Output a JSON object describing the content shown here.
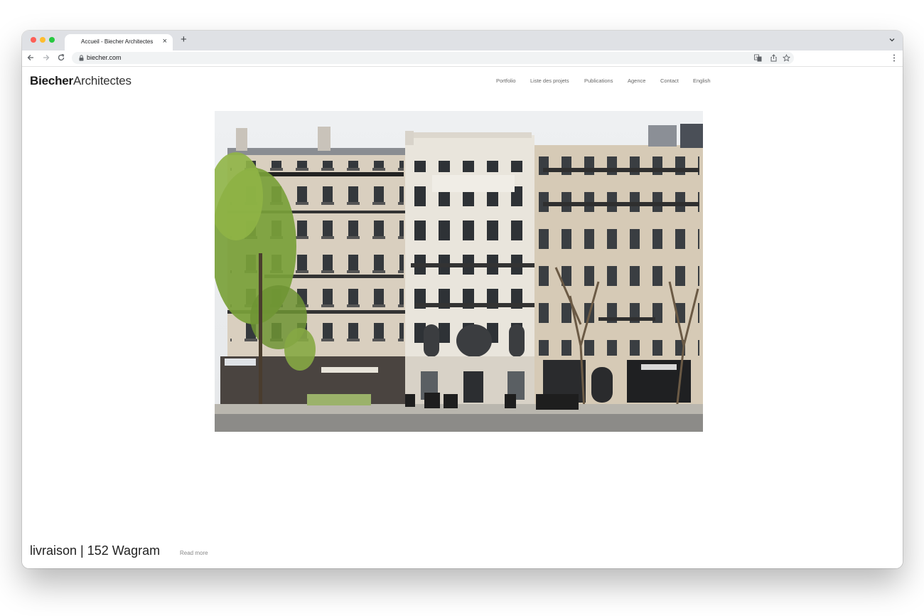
{
  "browser": {
    "tab_title": "Accueil - Biecher Architectes",
    "tab_close": "×",
    "new_tab": "+",
    "url": "biecher.com"
  },
  "site": {
    "logo_bold": "Biecher",
    "logo_light": "Architectes",
    "nav": [
      "Portfolio",
      "Liste des projets",
      "Publications",
      "Agence",
      "Contact",
      "English"
    ]
  },
  "hero": {
    "caption": "livraison | 152 Wagram",
    "read_more": "Read more"
  },
  "icons": {
    "back": "arrow-left-icon",
    "forward": "arrow-right-icon",
    "reload": "reload-icon",
    "lock": "lock-icon",
    "translate": "translate-icon",
    "share": "share-icon",
    "bookmark": "star-icon",
    "menu": "kebab-menu-icon"
  }
}
